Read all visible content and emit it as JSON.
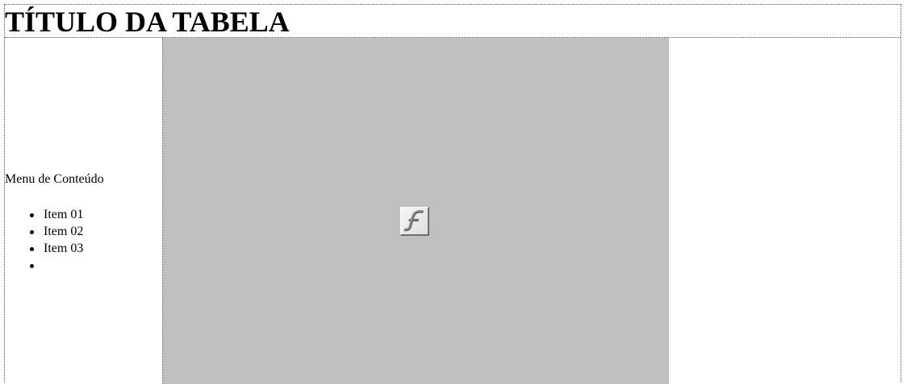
{
  "header": {
    "title": "TÍTULO DA TABELA"
  },
  "sidebar": {
    "menu_title": "Menu de Conteúdo",
    "items": [
      {
        "label": "Item 01"
      },
      {
        "label": "Item 02"
      },
      {
        "label": "Item 03"
      },
      {
        "label": ""
      }
    ]
  },
  "main": {
    "plugin_icon": "flash-player-icon",
    "plugin_background": "#c0c0c0"
  }
}
